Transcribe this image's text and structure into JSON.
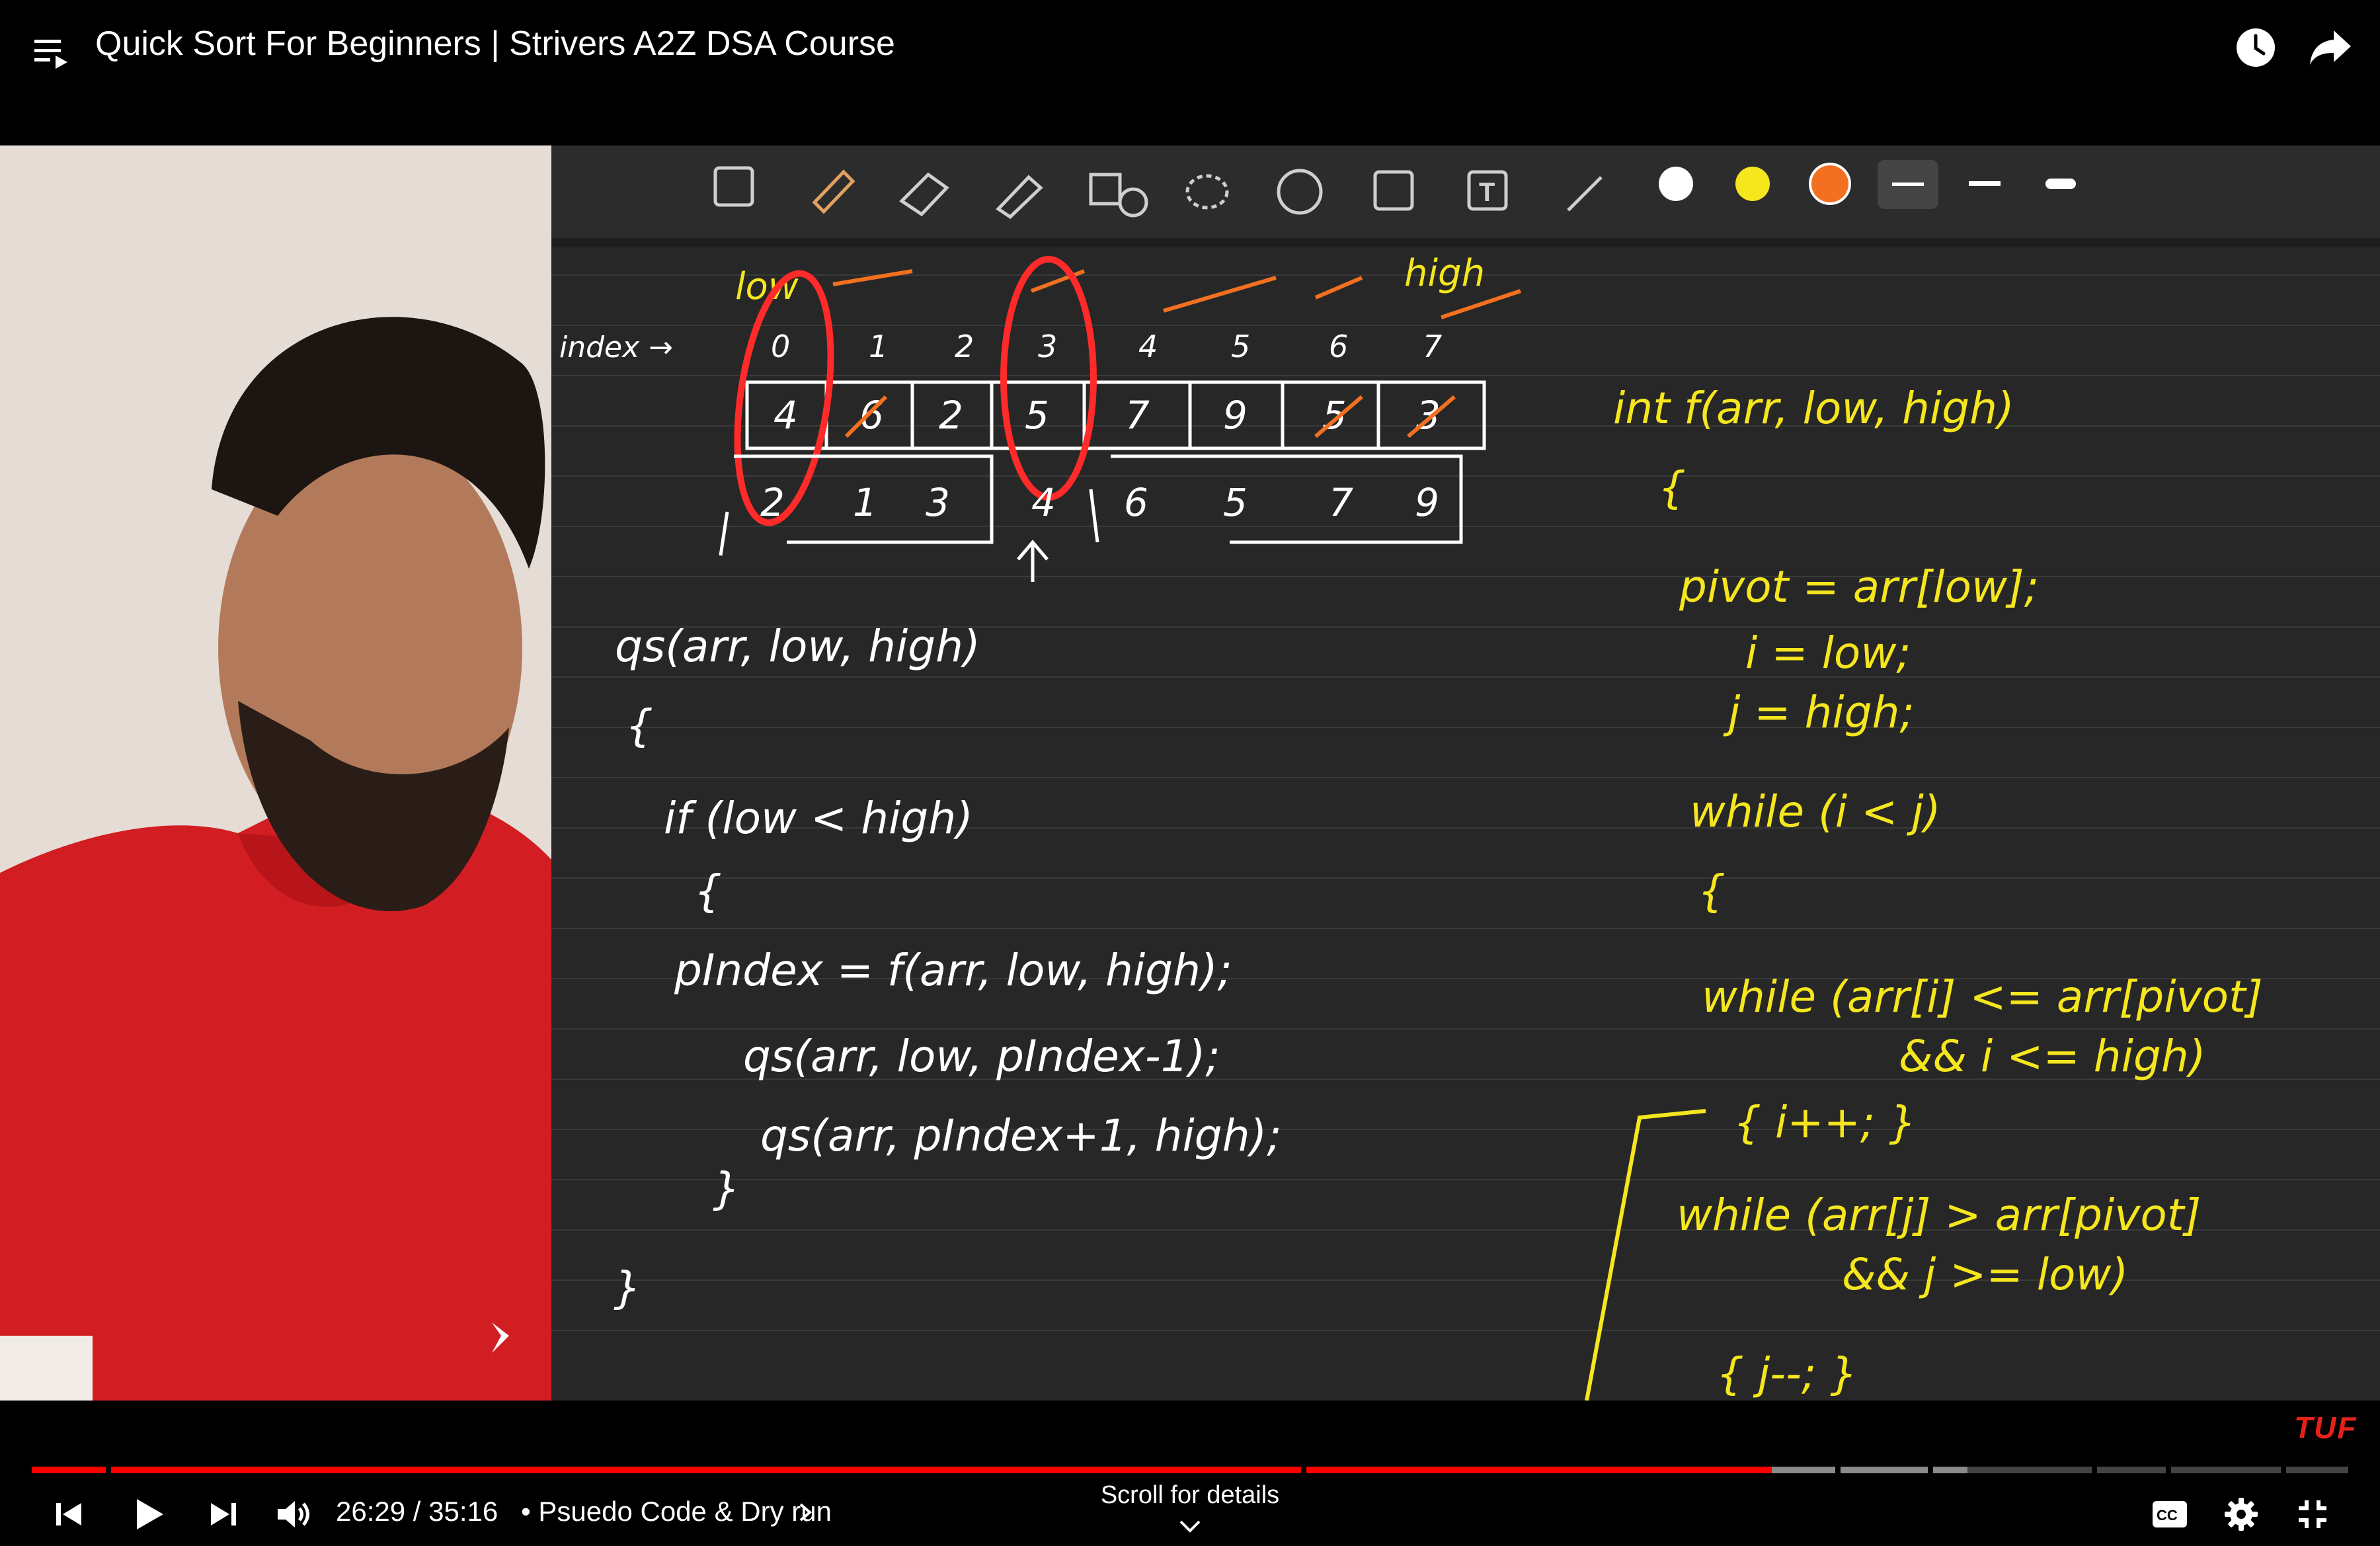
{
  "header": {
    "title": "Quick Sort For Beginners | Strivers A2Z DSA Course",
    "icons": [
      "playlist-icon",
      "watch-later-icon",
      "share-icon"
    ]
  },
  "player": {
    "time_current": "26:29",
    "time_total": "35:16",
    "time_display": "26:29 / 35:16",
    "separator": "•",
    "chapter": "Psuedo Code & Dry run",
    "scroll_hint": "Scroll for details",
    "watermark": "TUF",
    "progress_fraction": 0.751,
    "colors": {
      "played": "#ff0000",
      "buffered": "#8a8a8a",
      "unbuffered": "#444444"
    }
  },
  "whiteboard": {
    "index_label": "index →",
    "indices": [
      "0",
      "1",
      "2",
      "3",
      "4",
      "5",
      "6",
      "7"
    ],
    "array_values": [
      "4",
      "6",
      "2",
      "5",
      "7",
      "9",
      "5",
      "3"
    ],
    "result_values": [
      "2",
      "1",
      "3",
      "4",
      "6",
      "5",
      "7",
      "9"
    ],
    "pointer_labels": [
      "low",
      "high"
    ],
    "left_code": [
      "qs(arr, low, high)",
      "{",
      "if (low < high)",
      "{",
      "pIndex = f(arr, low, high);",
      "qs(arr, low, pIndex-1);",
      "qs(arr, pIndex+1, high);",
      "}",
      "}"
    ],
    "right_code": [
      "int f(arr, low, high)",
      "{",
      "pivot = arr[low];",
      "i = low;",
      "j = high;",
      "while (i < j)",
      "{",
      "while (arr[i] <= arr[pivot]",
      "&& i <= high)",
      "{ i++; }",
      "while (arr[j] > arr[pivot]",
      "&& j >= low)",
      "{ j--; }"
    ],
    "pen_colors": [
      "#ffffff",
      "#f5e61e",
      "#f37021"
    ]
  }
}
